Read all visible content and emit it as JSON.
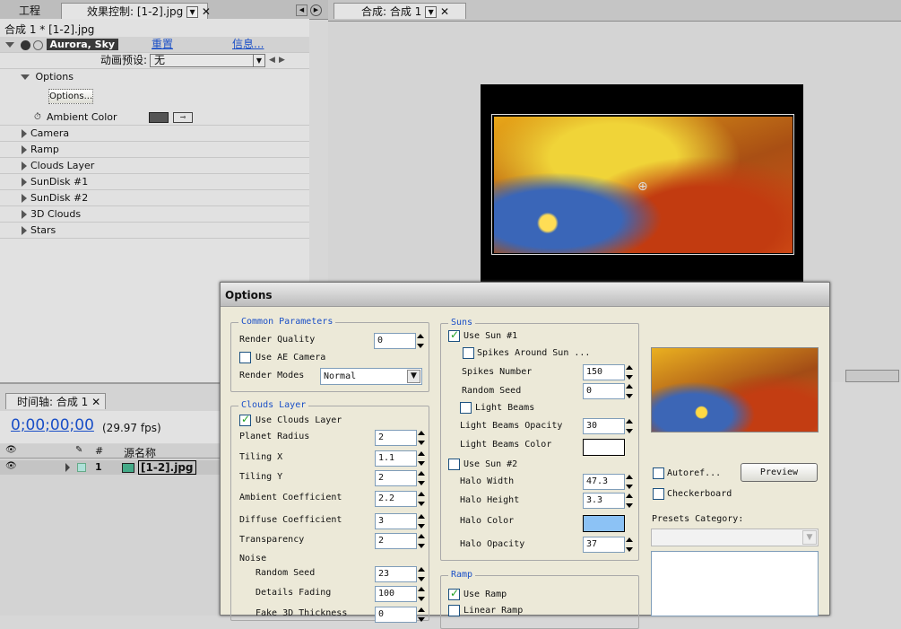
{
  "left_tabs": {
    "project": "工程",
    "effect_controls": "效果控制: [1-2].jpg"
  },
  "comp_tab": "合成: 合成 1",
  "breadcrumb": "合成 1 * [1-2].jpg",
  "effect": {
    "name": "Aurora, Sky",
    "reset": "重置",
    "about": "信息...",
    "preset_label": "动画预设:",
    "preset_value": "无",
    "options_section": "Options",
    "options_button": "Options...",
    "ambient_color": "Ambient Color",
    "groups": [
      "Camera",
      "Ramp",
      "Clouds Layer",
      "SunDisk #1",
      "SunDisk #2",
      "3D Clouds",
      "Stars"
    ]
  },
  "timeline": {
    "tab": "时间轴: 合成 1",
    "timecode": "0;00;00;00",
    "fps": "(29.97 fps)",
    "col_hash": "#",
    "col_source": "源名称",
    "layer_num": "1",
    "layer_name": "[1-2].jpg"
  },
  "dialog": {
    "title": "Options",
    "common": {
      "title": "Common Parameters",
      "render_quality": "Render Quality",
      "render_quality_val": "0",
      "use_ae_camera": "Use AE Camera",
      "render_modes": "Render Modes",
      "render_modes_val": "Normal"
    },
    "clouds": {
      "title": "Clouds Layer",
      "use": "Use Clouds Layer",
      "rows": [
        {
          "label": "Planet Radius",
          "val": "2"
        },
        {
          "label": "Tiling X",
          "val": "1.1"
        },
        {
          "label": "Tiling Y",
          "val": "2"
        },
        {
          "label": "Ambient Coefficient",
          "val": "2.2"
        },
        {
          "label": "Diffuse Coefficient",
          "val": "3"
        },
        {
          "label": "Transparency",
          "val": "2"
        }
      ],
      "noise": "Noise",
      "noise_rows": [
        {
          "label": "Random Seed",
          "val": "23"
        },
        {
          "label": "Details Fading",
          "val": "100"
        },
        {
          "label": "Fake 3D Thickness",
          "val": "0"
        }
      ]
    },
    "suns": {
      "title": "Suns",
      "use_sun1": "Use Sun #1",
      "spikes_around": "Spikes Around Sun ...",
      "spikes_number": "Spikes Number",
      "spikes_number_val": "150",
      "random_seed": "Random Seed",
      "random_seed_val": "0",
      "light_beams": "Light Beams",
      "lb_opacity": "Light Beams Opacity",
      "lb_opacity_val": "30",
      "lb_color": "Light Beams Color",
      "use_sun2": "Use Sun #2",
      "halo_width": "Halo Width",
      "halo_width_val": "47.3",
      "halo_height": "Halo Height",
      "halo_height_val": "3.3",
      "halo_color": "Halo Color",
      "halo_opacity": "Halo Opacity",
      "halo_opacity_val": "37"
    },
    "ramp": {
      "title": "Ramp",
      "use_ramp": "Use Ramp",
      "linear_ramp": "Linear Ramp"
    },
    "autoref": "Autoref...",
    "preview": "Preview",
    "checkerboard": "Checkerboard",
    "presets_category": "Presets Category:"
  },
  "colors": {
    "halo": "#8cc2f5",
    "lb": "#ffffff",
    "link": "#1a4fc7"
  }
}
